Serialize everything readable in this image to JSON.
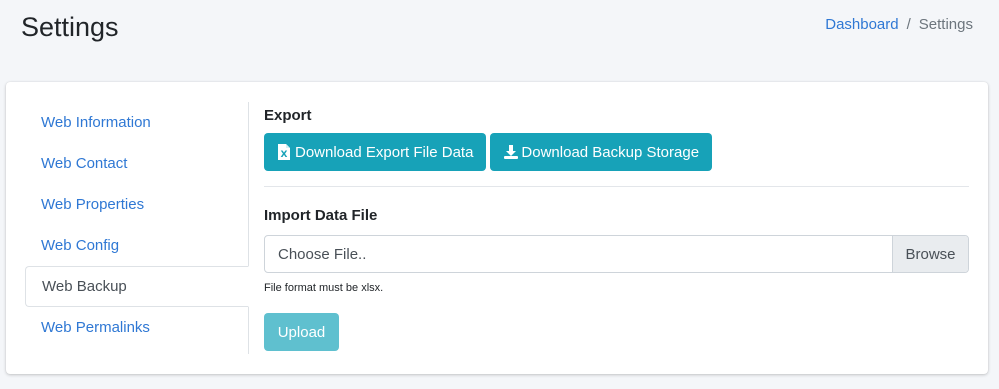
{
  "header": {
    "title": "Settings",
    "breadcrumb": {
      "home": "Dashboard",
      "separator": "/",
      "current": "Settings"
    }
  },
  "sidebar": {
    "items": [
      {
        "label": "Web Information"
      },
      {
        "label": "Web Contact"
      },
      {
        "label": "Web Properties"
      },
      {
        "label": "Web Config"
      },
      {
        "label": "Web Backup",
        "active": true
      },
      {
        "label": "Web Permalinks"
      }
    ]
  },
  "export": {
    "label": "Export",
    "download_export_label": "Download Export File Data",
    "download_export_icon": "file-excel-icon",
    "download_backup_label": "Download Backup Storage",
    "download_backup_icon": "download-icon"
  },
  "import": {
    "label": "Import Data File",
    "file_placeholder": "Choose File..",
    "browse_label": "Browse",
    "help_text": "File format must be xlsx.",
    "upload_label": "Upload"
  },
  "colors": {
    "primary_info": "#17a2b8",
    "link": "#2f78d4",
    "background": "#f4f6f9"
  }
}
